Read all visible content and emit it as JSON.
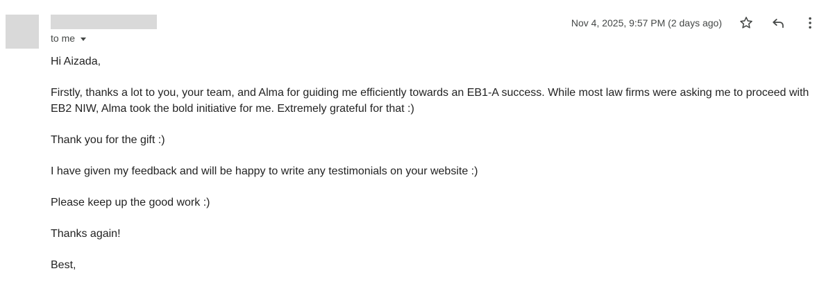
{
  "message": {
    "recipient_label": "to me",
    "date": "Nov 4, 2025, 9:57 PM (2 days ago)",
    "icons": {
      "star": "star-icon",
      "reply": "reply-icon",
      "more": "more-vert-icon"
    },
    "body": [
      "Hi Aizada,",
      "Firstly, thanks a lot to you, your team, and Alma for guiding me efficiently towards an EB1-A success. While most law firms were asking me to proceed with EB2 NIW, Alma took the bold initiative for me. Extremely grateful for that :)",
      "Thank you for the gift :)",
      "I have given my feedback and will be happy to write any testimonials on your website :)",
      "Please keep up the good work :)",
      "Thanks again!",
      "Best,"
    ]
  },
  "colors": {
    "redaction": "#d9d9d9",
    "text": "#222222",
    "meta": "#444746"
  }
}
